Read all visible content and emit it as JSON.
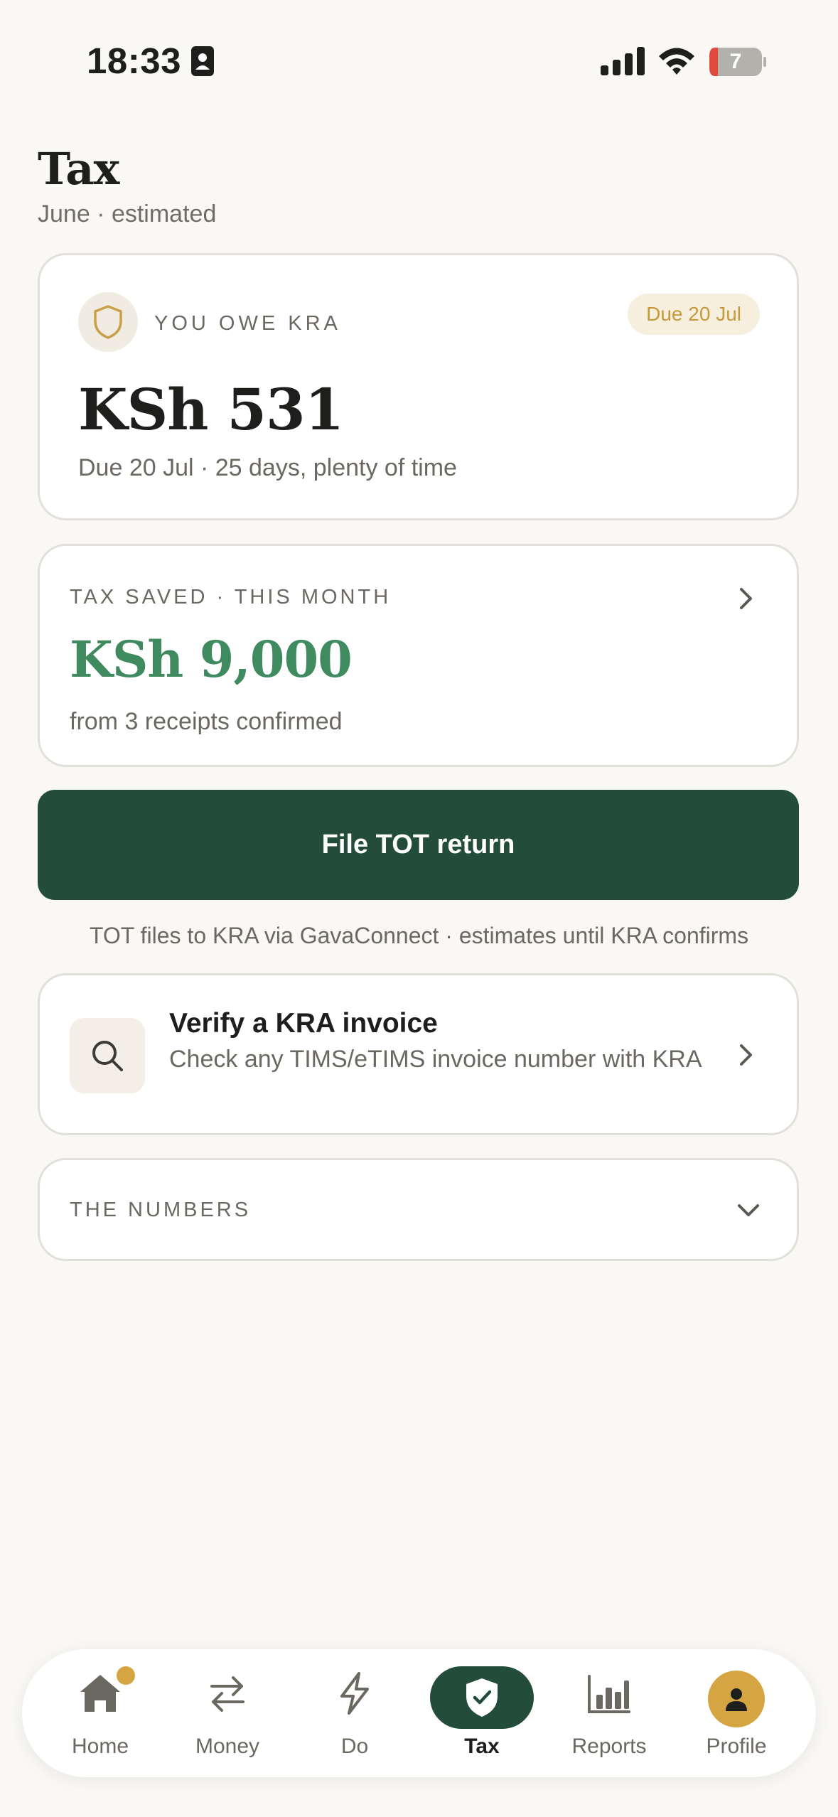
{
  "status_bar": {
    "time": "18:33",
    "battery_level": "7",
    "icons": [
      "contact-card-icon",
      "signal-icon",
      "wifi-icon",
      "battery-icon"
    ]
  },
  "header": {
    "title": "Tax",
    "subtitle": "June · estimated"
  },
  "owe_card": {
    "label": "YOU OWE KRA",
    "due_badge": "Due 20 Jul",
    "amount": "KSh 531",
    "note": "Due 20 Jul · 25 days, plenty of time",
    "icon": "shield-icon"
  },
  "saved_card": {
    "label": "TAX SAVED · THIS MONTH",
    "amount": "KSh 9,000",
    "note": "from 3 receipts confirmed",
    "icon": "chevron-right-icon"
  },
  "file_button": {
    "label": "File TOT return",
    "note": "TOT files to KRA via GavaConnect · estimates until KRA confirms"
  },
  "verify_card": {
    "title": "Verify a KRA invoice",
    "subtitle": "Check any TIMS/eTIMS invoice number with KRA",
    "icon": "search-icon"
  },
  "numbers_card": {
    "label": "THE NUMBERS",
    "icon": "chevron-down-icon"
  },
  "tabbar": {
    "items": [
      {
        "label": "Home",
        "icon": "home-icon",
        "badge": true
      },
      {
        "label": "Money",
        "icon": "transfer-arrows-icon"
      },
      {
        "label": "Do",
        "icon": "lightning-icon"
      },
      {
        "label": "Tax",
        "icon": "shield-check-icon",
        "active": true
      },
      {
        "label": "Reports",
        "icon": "bar-chart-icon"
      },
      {
        "label": "Profile",
        "icon": "person-icon"
      }
    ]
  },
  "colors": {
    "background": "#f9f8f4",
    "primary_green": "#234c3a",
    "saved_green": "#3f8a5f",
    "gold": "#d4a542",
    "muted_text": "#6b6862"
  }
}
